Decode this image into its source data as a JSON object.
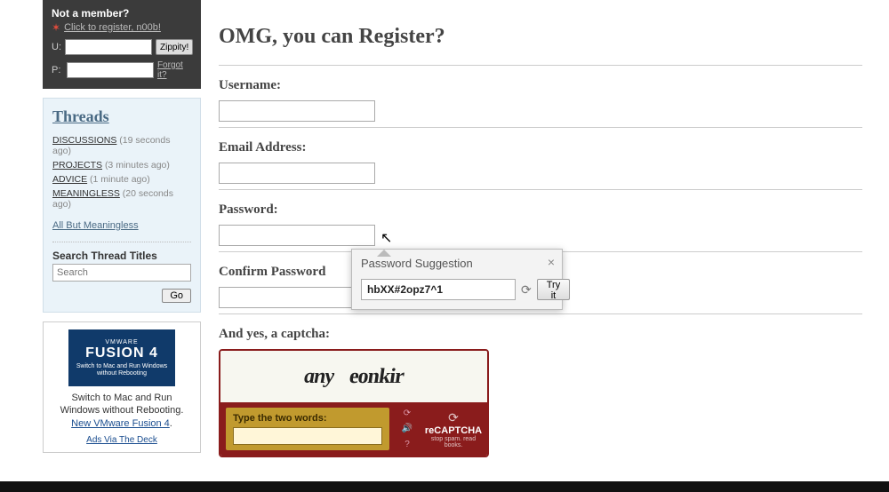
{
  "login": {
    "not_member": "Not a member?",
    "register_link": "Click to register, n00b!",
    "u_label": "U:",
    "p_label": "P:",
    "zip_btn": "Zippity!",
    "forgot": "Forgot it?"
  },
  "threads": {
    "title": "Threads",
    "items": [
      {
        "name": "DISCUSSIONS",
        "ago": "(19 seconds ago)"
      },
      {
        "name": "PROJECTS",
        "ago": "(3 minutes ago)"
      },
      {
        "name": "ADVICE",
        "ago": "(1 minute ago)"
      },
      {
        "name": "MEANINGLESS",
        "ago": "(20 seconds ago)"
      }
    ],
    "abm": "All But Meaningless",
    "search_label": "Search Thread Titles",
    "search_placeholder": "Search",
    "go": "Go"
  },
  "ad": {
    "brand_top": "VMWARE",
    "brand": "FUSION 4",
    "img_cap": "Switch to Mac and Run Windows without Rebooting",
    "caption_pre": "Switch to Mac and Run Windows without Rebooting. ",
    "caption_link": "New VMware Fusion 4",
    "caption_post": ".",
    "via": "Ads Via The Deck"
  },
  "form": {
    "heading": "OMG, you can Register?",
    "username": "Username:",
    "email": "Email Address:",
    "password": "Password:",
    "confirm": "Confirm Password",
    "captcha": "And yes, a captcha:"
  },
  "captcha": {
    "w1": "any",
    "w2": "eonkir",
    "ttw": "Type the two words:",
    "brand": "reCAPTCHA",
    "tag": "stop spam. read books."
  },
  "popup": {
    "title": "Password Suggestion",
    "value": "hbXX#2opz7^1",
    "try": "Try it"
  }
}
